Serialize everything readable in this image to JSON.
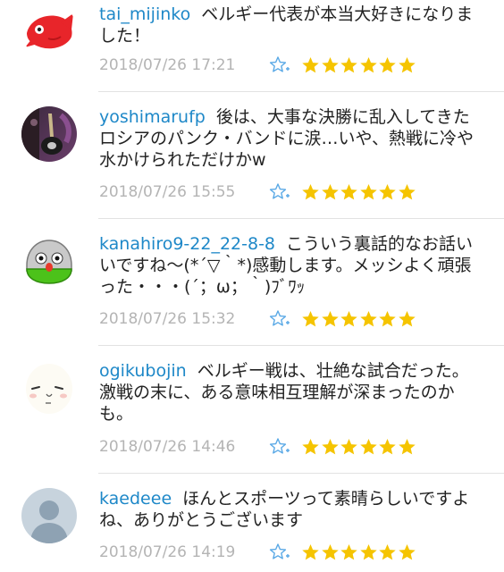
{
  "colors": {
    "username": "#1e88c8",
    "text": "#222222",
    "timestamp": "#b4b4b4",
    "star": "#f5c400",
    "fav_outline": "#5aa9e6"
  },
  "comments": [
    {
      "username": "tai_mijinko",
      "text": "ベルギー代表が本当大好きになりました！",
      "timestamp": "2018/07/26 17:21",
      "avatar": "red-fish-avatar",
      "stars": 6
    },
    {
      "username": "yoshimarufp",
      "text": "後は、大事な決勝に乱入してきたロシアのパンク・バンドに涙…いや、熱戦に冷や水かけられただけかw",
      "timestamp": "2018/07/26 15:55",
      "avatar": "guitar-photo-avatar",
      "stars": 6
    },
    {
      "username": "kanahiro9-22_22-8-8",
      "text": "こういう裏話的なお話いいですね〜(*´▽｀*)感動します。メッシよく頑張った・・・(´；ω；｀)ﾌﾞﾜｯ",
      "timestamp": "2018/07/26 15:32",
      "avatar": "green-character-avatar",
      "stars": 6
    },
    {
      "username": "ogikubojin",
      "text": "ベルギー戦は、壮絶な試合だった。激戦の末に、ある意味相互理解が深まったのかも。",
      "timestamp": "2018/07/26 14:46",
      "avatar": "face-drawing-avatar",
      "stars": 6
    },
    {
      "username": "kaedeee",
      "text": "ほんとスポーツって素晴らしいですよね、ありがとうございます",
      "timestamp": "2018/07/26 14:19",
      "avatar": "default-user-avatar",
      "stars": 6
    }
  ]
}
